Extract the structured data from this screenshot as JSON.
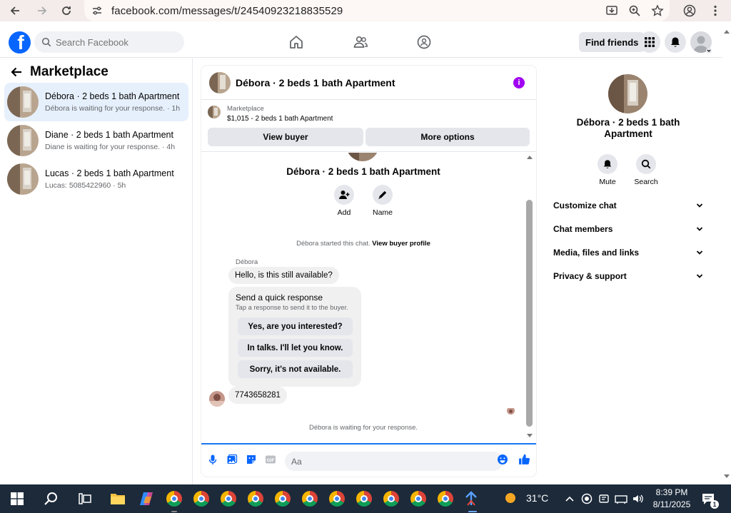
{
  "browser": {
    "url": "facebook.com/messages/t/24540923218835529"
  },
  "fb_header": {
    "search_placeholder": "Search Facebook",
    "find_friends_label": "Find friends"
  },
  "left_panel": {
    "title": "Marketplace",
    "conversations": [
      {
        "name": "Débora · 2 beds 1 bath Apartment",
        "subtitle": "Débora is waiting for your response. · 1h",
        "active": true
      },
      {
        "name": "Diane · 2 beds 1 bath Apartment",
        "subtitle": "Diane is waiting for your response. · 4h",
        "active": false
      },
      {
        "name": "Lucas · 2 beds 1 bath Apartment",
        "subtitle": "Lucas: 5085422960 · 5h",
        "active": false
      }
    ]
  },
  "chat": {
    "header_title": "Débora · 2 beds 1 bath Apartment",
    "marketplace_label": "Marketplace",
    "listing": "$1,015 - 2 beds 1 bath Apartment",
    "view_buyer_label": "View buyer",
    "more_options_label": "More options",
    "body_title": "Débora · 2 beds 1 bath Apartment",
    "add_label": "Add",
    "name_label": "Name",
    "started_text": "Débora started this chat.",
    "view_buyer_profile": "View buyer profile",
    "sender_name": "Débora",
    "first_message": "Hello, is this still available?",
    "quick_response_title": "Send a quick response",
    "quick_response_sub": "Tap a response to send it to the buyer.",
    "quick_responses": [
      "Yes, are you interested?",
      "In talks. I'll let you know.",
      "Sorry, it's not available."
    ],
    "phone_message": "7743658281",
    "waiting_text": "Débora is waiting for your response.",
    "composer_placeholder": "Aa"
  },
  "right_panel": {
    "name": "Débora · 2 beds 1 bath Apartment",
    "mute_label": "Mute",
    "search_label": "Search",
    "sections": [
      "Customize chat",
      "Chat members",
      "Media, files and links",
      "Privacy & support"
    ]
  },
  "taskbar": {
    "temperature": "31°C",
    "time": "8:39 PM",
    "date": "8/11/2025",
    "notification_count": "1"
  },
  "colors": {
    "fb_blue": "#0866ff",
    "accent_purple": "#a100f2",
    "active_row": "#e6f0fc"
  }
}
